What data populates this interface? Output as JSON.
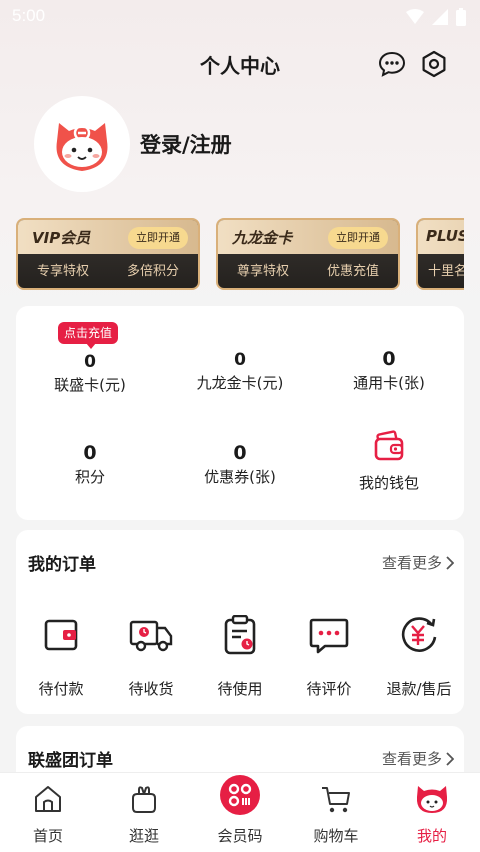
{
  "status": {
    "time": "5:00"
  },
  "header": {
    "title": "个人中心"
  },
  "profile": {
    "login_label": "登录/注册"
  },
  "member_cards": [
    {
      "name": "VIP会员",
      "button": "立即开通",
      "features": [
        "专享特权",
        "多倍积分"
      ]
    },
    {
      "name": "九龙金卡",
      "button": "立即开通",
      "features": [
        "尊享特权",
        "优惠充值"
      ]
    },
    {
      "name": "PLUS",
      "features": [
        "十里名"
      ]
    }
  ],
  "stats": {
    "badge": "点击充值",
    "items": [
      {
        "value": "0",
        "label": "联盛卡(元)"
      },
      {
        "value": "0",
        "label": "九龙金卡(元)"
      },
      {
        "value": "0",
        "label": "通用卡(张)"
      },
      {
        "value": "0",
        "label": "积分"
      },
      {
        "value": "0",
        "label": "优惠券(张)"
      },
      {
        "label": "我的钱包"
      }
    ]
  },
  "orders": {
    "title": "我的订单",
    "more": "查看更多",
    "items": [
      {
        "label": "待付款",
        "icon": "wallet-icon"
      },
      {
        "label": "待收货",
        "icon": "truck-icon"
      },
      {
        "label": "待使用",
        "icon": "clipboard-icon"
      },
      {
        "label": "待评价",
        "icon": "comment-icon"
      },
      {
        "label": "退款/售后",
        "icon": "refund-icon"
      }
    ]
  },
  "group_orders": {
    "title": "联盛团订单",
    "more": "查看更多"
  },
  "tabbar": [
    {
      "label": "首页",
      "icon": "home-icon"
    },
    {
      "label": "逛逛",
      "icon": "bag-icon"
    },
    {
      "label": "会员码",
      "icon": "member-code-icon"
    },
    {
      "label": "购物车",
      "icon": "cart-icon"
    },
    {
      "label": "我的",
      "icon": "mascot-icon",
      "active": true
    }
  ],
  "colors": {
    "accent": "#e61f44",
    "gold": "#d9b07a",
    "active_tab": "#e61f44"
  }
}
